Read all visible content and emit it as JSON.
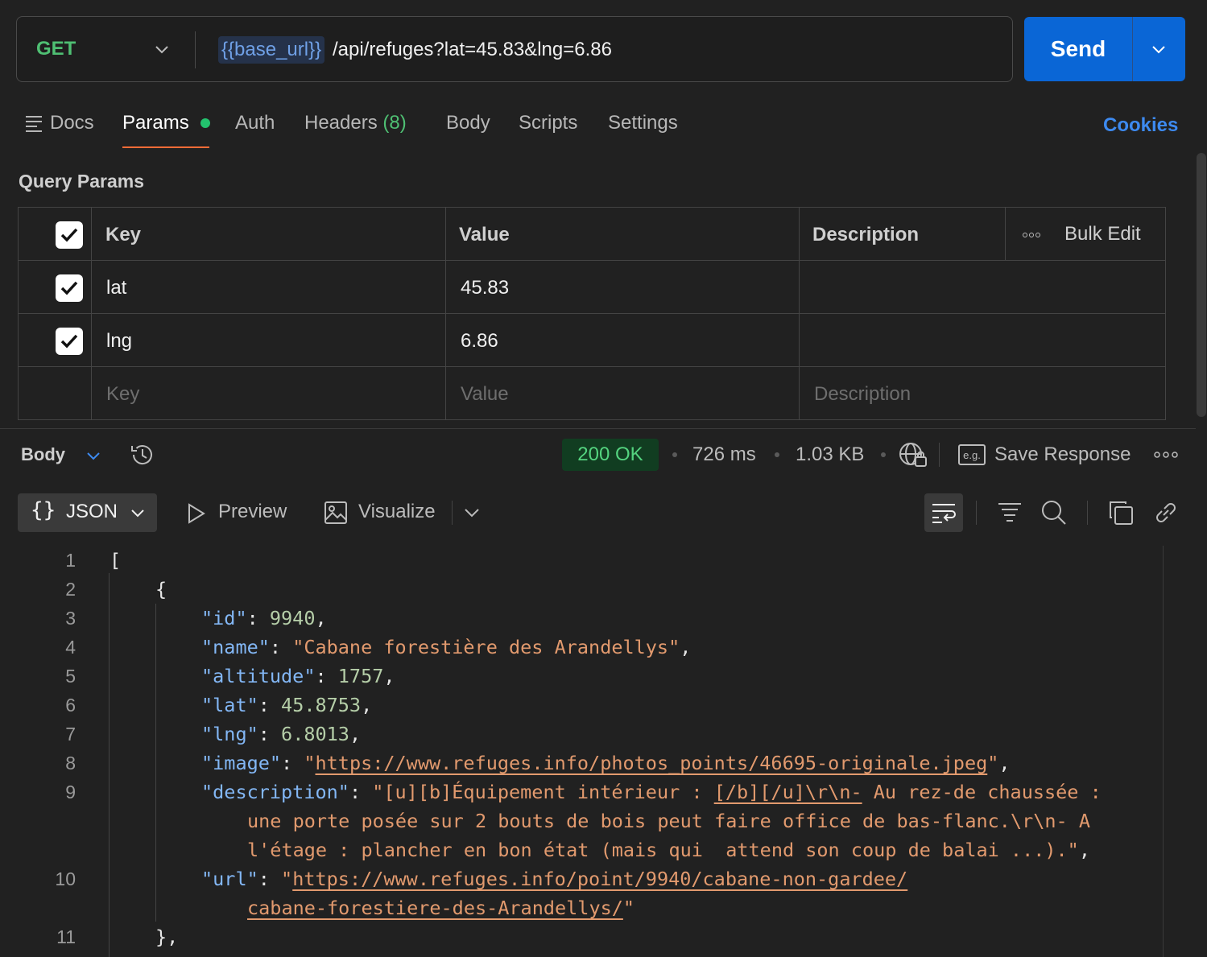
{
  "request": {
    "method": "GET",
    "url_variable": "{{base_url}}",
    "url_path": "/api/refuges?lat=45.83&lng=6.86",
    "send_label": "Send"
  },
  "tabs": {
    "docs": "Docs",
    "params": "Params",
    "auth": "Auth",
    "headers": "Headers",
    "headers_count": "(8)",
    "body": "Body",
    "scripts": "Scripts",
    "settings": "Settings",
    "cookies": "Cookies"
  },
  "query_params": {
    "title": "Query Params",
    "headers": {
      "key": "Key",
      "value": "Value",
      "description": "Description",
      "bulk_edit": "Bulk Edit"
    },
    "rows": [
      {
        "key": "lat",
        "value": "45.83",
        "checked": true
      },
      {
        "key": "lng",
        "value": "6.86",
        "checked": true
      }
    ],
    "placeholders": {
      "key": "Key",
      "value": "Value",
      "description": "Description"
    }
  },
  "response": {
    "body_label": "Body",
    "status": "200 OK",
    "time": "726 ms",
    "size": "1.03 KB",
    "save_label": "Save Response",
    "format": "JSON",
    "preview": "Preview",
    "visualize": "Visualize"
  },
  "code_lines": {
    "l1": "[",
    "l2": "{",
    "id_key": "\"id\"",
    "id_val": "9940",
    "name_key": "\"name\"",
    "name_val": "\"Cabane forestière des Arandellys\"",
    "alt_key": "\"altitude\"",
    "alt_val": "1757",
    "lat_key": "\"lat\"",
    "lat_val": "45.8753",
    "lng_key": "\"lng\"",
    "lng_val": "6.8013",
    "img_key": "\"image\"",
    "img_url": "https://www.refuges.info/photos_points/46695-originale.jpeg",
    "desc_key": "\"description\"",
    "desc_a": "\"[u][b]Équipement intérieur : ",
    "desc_b": "[/b][/u]\\r\\n-",
    "desc_c": " Au rez-de chaussée :",
    "desc_2": "une porte posée sur 2 bouts de bois peut faire office de bas-flanc.\\r\\n- A",
    "desc_3": "l'étage : plancher en bon état (mais qui  attend son coup de balai ...).\"",
    "url_key": "\"url\"",
    "url_1": "https://www.refuges.info/point/9940/cabane-non-gardee/",
    "url_2": "cabane-forestiere-des-Arandellys/",
    "l11": "},"
  }
}
